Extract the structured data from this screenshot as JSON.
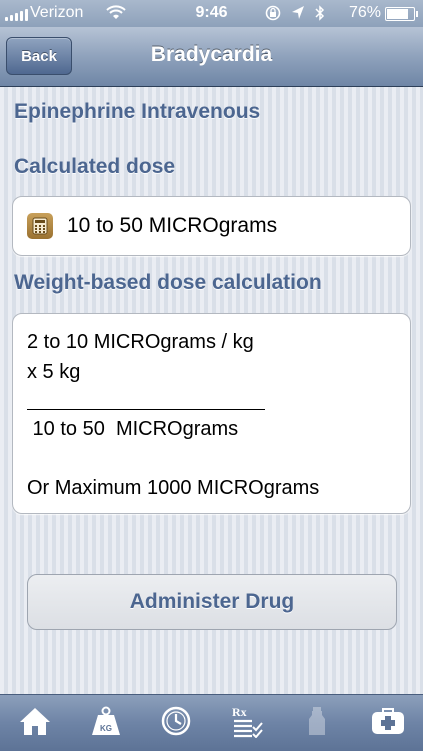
{
  "status_bar": {
    "carrier": "Verizon",
    "time": "9:46",
    "battery_percent": "76%",
    "battery_level": 0.76
  },
  "nav": {
    "back_label": "Back",
    "title": "Bradycardia"
  },
  "drug_name": "Epinephrine Intravenous",
  "calculated": {
    "heading": "Calculated dose",
    "value": "10 to 50 MICROgrams"
  },
  "weight_based": {
    "heading": "Weight-based dose calculation",
    "line1": "2 to 10 MICROgrams / kg",
    "line2": "x 5 kg",
    "result": " 10 to 50  MICROgrams",
    "maximum": "Or Maximum 1000 MICROgrams"
  },
  "administer_label": "Administer Drug",
  "tabs": [
    {
      "icon": "home-icon"
    },
    {
      "icon": "weight-icon",
      "label": "KG"
    },
    {
      "icon": "clock-icon"
    },
    {
      "icon": "prescription-list-icon",
      "label": "Rx"
    },
    {
      "icon": "bottle-icon"
    },
    {
      "icon": "medical-kit-icon"
    }
  ]
}
